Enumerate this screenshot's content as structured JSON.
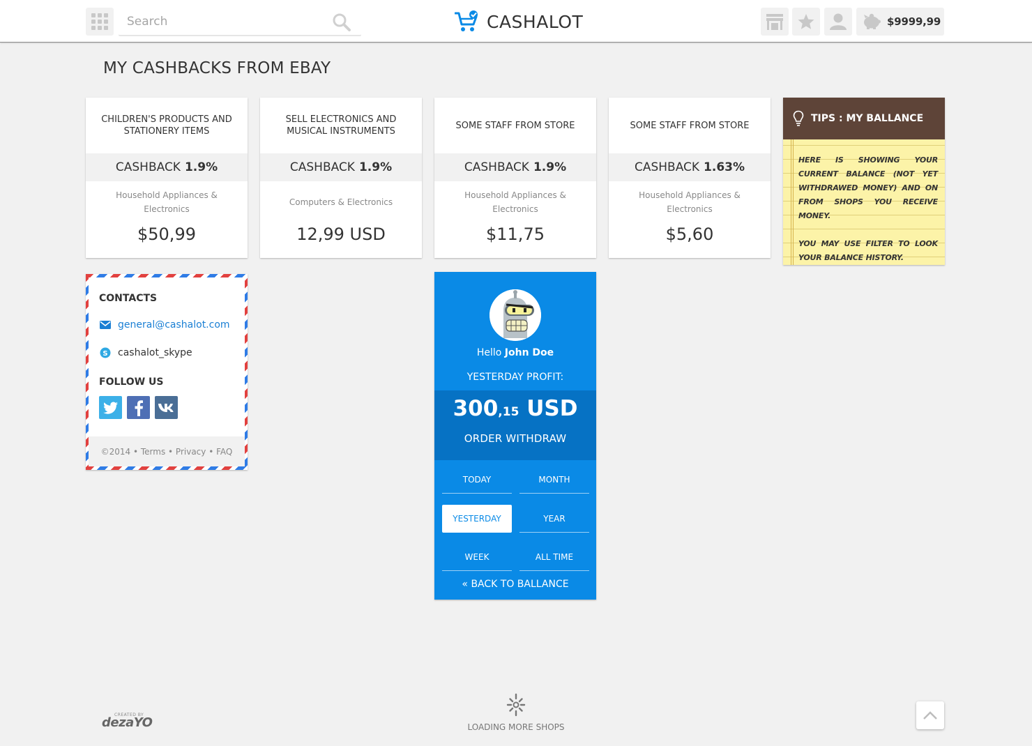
{
  "header": {
    "search_placeholder": "Search",
    "logo_text": "CASHALOT",
    "balance": "$9999,99",
    "accent_color": "#0a8ae6"
  },
  "page_title": "MY CASHBACKS FROM EBAY",
  "cards": [
    {
      "title": "CHILDREN'S PRODUCTS AND STATIONERY ITEMS",
      "cashback_label": "CASHBACK",
      "cashback_value": "1.9%",
      "category": "Household Appliances & Electronics",
      "price": "$50,99"
    },
    {
      "title": "SELL ELECTRONICS AND MUSICAL INSTRUMENTS",
      "cashback_label": "CASHBACK",
      "cashback_value": "1.9%",
      "category": "Computers & Electronics",
      "price": "12,99 USD"
    },
    {
      "title": "SOME STAFF FROM STORE",
      "cashback_label": "CASHBACK",
      "cashback_value": "1.9%",
      "category": "Household Appliances & Electronics",
      "price": "$11,75"
    },
    {
      "title": "SOME STAFF FROM STORE",
      "cashback_label": "CASHBACK",
      "cashback_value": "1.63%",
      "category": "Household Appliances & Electronics",
      "price": "$5,60"
    }
  ],
  "tips": {
    "title": "TIPS : MY BALLANCE",
    "paragraph1": "HERE IS SHOWING YOUR CURRENT BALANCE (NOT YET WITHDRAWED MONEY) AND ON FROM SHOPS YOU RECEIVE MONEY.",
    "paragraph2": "YOU MAY USE FILTER TO LOOK YOUR BALANCE HISTORY."
  },
  "contacts": {
    "heading": "CONTACTS",
    "email": "general@cashalot.com",
    "skype": "cashalot_skype",
    "follow_heading": "FOLLOW US",
    "footer": "©2014 • Terms • Privacy  • FAQ"
  },
  "profile": {
    "hello": "Hello",
    "name": "John Doe",
    "profit_label": "YESTERDAY PROFIT:",
    "profit_whole": "300",
    "profit_cents": ",15",
    "profit_currency": "USD",
    "withdraw_label": "ORDER WITHDRAW",
    "periods": [
      "TODAY",
      "MONTH",
      "YESTERDAY",
      "YEAR",
      "WEEK",
      "ALL TIME"
    ],
    "active_period": "YESTERDAY",
    "back_label": "« BACK TO BALLANCE"
  },
  "footer": {
    "created_by": "CREATED BY",
    "brand": "dezaYO",
    "loading": "LOADING MORE SHOPS"
  }
}
